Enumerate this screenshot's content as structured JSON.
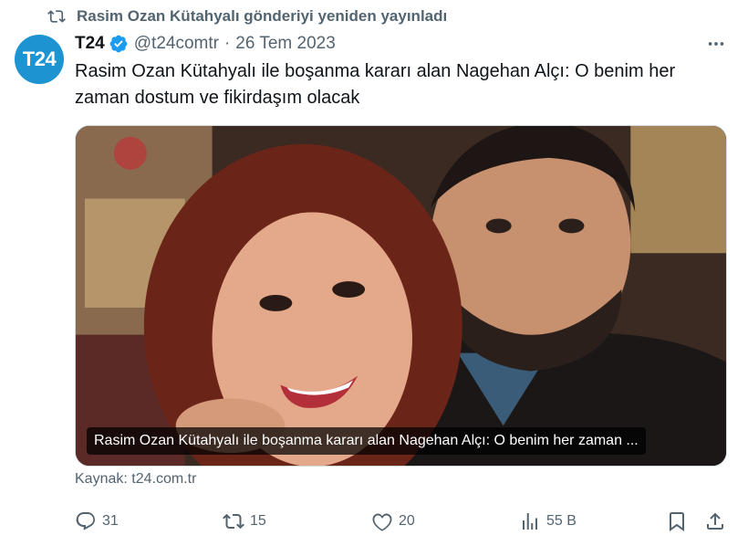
{
  "retweet": {
    "label": "Rasim Ozan Kütahyalı gönderiyi yeniden yayınladı"
  },
  "author": {
    "avatar_text": "T24",
    "name": "T24",
    "handle": "@t24comtr",
    "separator": "·",
    "date": "26 Tem 2023",
    "verified": true
  },
  "tweet": {
    "text": "Rasim Ozan Kütahyalı ile boşanma kararı alan Nagehan Alçı: O benim her zaman dostum ve fikirdaşım olacak"
  },
  "card": {
    "caption": "Rasim Ozan Kütahyalı ile boşanma kararı alan Nagehan Alçı: O benim her zaman ...",
    "source": "Kaynak: t24.com.tr"
  },
  "actions": {
    "replies": "31",
    "reposts": "15",
    "likes": "20",
    "views": "55 B"
  },
  "colors": {
    "accent": "#1d9bf0",
    "muted": "#536471",
    "avatar_bg": "#1d93d2"
  }
}
